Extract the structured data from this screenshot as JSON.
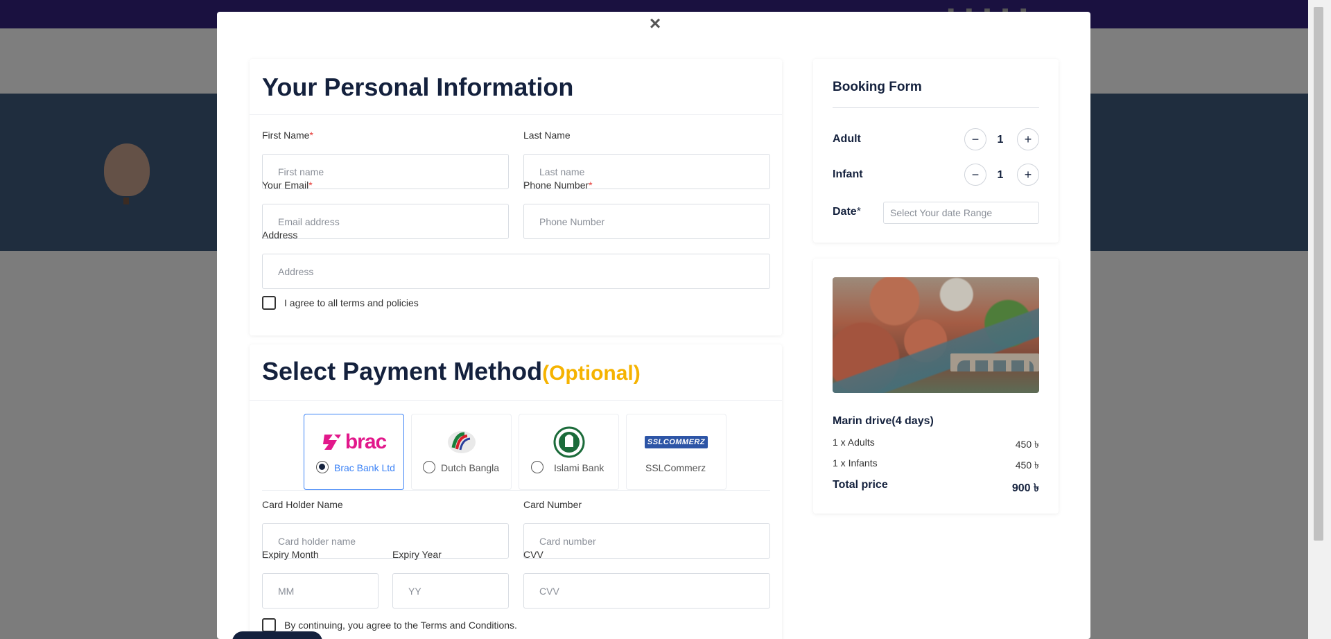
{
  "personal": {
    "title": "Your Personal Information",
    "first_name": {
      "label": "First Name",
      "required": "*",
      "placeholder": "First name"
    },
    "last_name": {
      "label": "Last Name",
      "placeholder": "Last name"
    },
    "email": {
      "label": "Your Email",
      "required": "*",
      "placeholder": "Email address"
    },
    "phone": {
      "label": "Phone Number",
      "required": "*",
      "placeholder": "Phone Number"
    },
    "address": {
      "label": "Address",
      "placeholder": "Address"
    },
    "agree_label": "I agree to all terms and policies"
  },
  "payment": {
    "title": "Select Payment Method",
    "title_suffix": "(Optional)",
    "title_suffix_color": "#f5b301",
    "methods": [
      {
        "name": "Brac Bank Ltd",
        "logo_text": "brac",
        "selected": true
      },
      {
        "name": "Dutch Bangla",
        "selected": false
      },
      {
        "name": "Islami Bank",
        "selected": false
      },
      {
        "name": "SSLCommerz",
        "logo_text": "SSLCOMMERZ",
        "selected": false
      }
    ],
    "card_holder": {
      "label": "Card Holder Name",
      "placeholder": "Card holder name"
    },
    "card_number": {
      "label": "Card Number",
      "placeholder": "Card number"
    },
    "expiry_month": {
      "label": "Expiry Month",
      "placeholder": "MM"
    },
    "expiry_year": {
      "label": "Expiry Year",
      "placeholder": "YY"
    },
    "cvv": {
      "label": "CVV",
      "placeholder": "CVV"
    },
    "terms_label": "By continuing, you agree to the Terms and Conditions."
  },
  "booking": {
    "title": "Booking Form",
    "adult_label": "Adult",
    "adult_qty": "1",
    "infant_label": "Infant",
    "infant_qty": "1",
    "minus": "−",
    "plus": "+",
    "date_label": "Date",
    "date_required": "*",
    "date_placeholder": "Select Your date Range"
  },
  "summary": {
    "tour_name": "Marin drive(4 days)",
    "adults_line": "1 x Adults",
    "adults_price": "450 ৳",
    "infants_line": "1 x Infants",
    "infants_price": "450 ৳",
    "total_label": "Total price",
    "total_value": "900 ৳"
  },
  "modal": {
    "close": "×"
  },
  "colors": {
    "primary": "#14213d",
    "accent": "#3b82f6",
    "required": "#e53935"
  }
}
